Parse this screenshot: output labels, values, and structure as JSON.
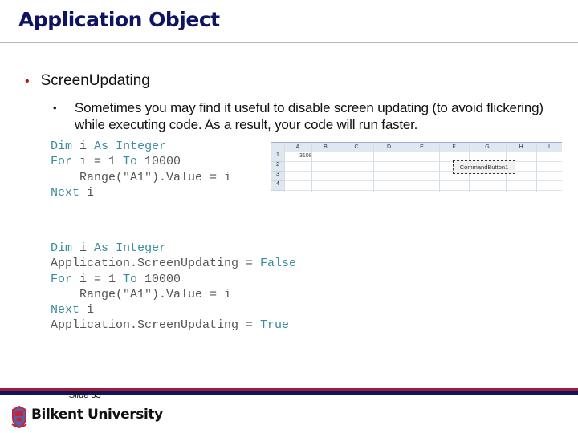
{
  "slide": {
    "title": "Application Object",
    "bullet_level1": "ScreenUpdating",
    "bullet_level2": "Sometimes you may find it useful to disable screen updating (to avoid flickering) while executing code. As a result, your code will run faster.",
    "bullet_char": "•"
  },
  "code_block_1": {
    "lines": [
      {
        "kw1": "Dim",
        "t1": " i ",
        "kw2": "As",
        "t2": " ",
        "kw3": "Integer",
        "t3": ""
      },
      {
        "kw1": "For",
        "t1": " i = 1 ",
        "kw2": "To",
        "t2": " 10000",
        "kw3": "",
        "t3": ""
      },
      {
        "kw1": "",
        "t1": "    Range(\"A1\").Value = i",
        "kw2": "",
        "t2": "",
        "kw3": "",
        "t3": ""
      },
      {
        "kw1": "Next",
        "t1": " i",
        "kw2": "",
        "t2": "",
        "kw3": "",
        "t3": ""
      }
    ]
  },
  "code_block_2": {
    "lines": [
      {
        "kw1": "Dim",
        "t1": " i ",
        "kw2": "As",
        "t2": " ",
        "kw3": "Integer",
        "t3": ""
      },
      {
        "kw1": "",
        "t1": "Application.ScreenUpdating = ",
        "kw2": "False",
        "t2": "",
        "kw3": "",
        "t3": ""
      },
      {
        "kw1": "For",
        "t1": " i = 1 ",
        "kw2": "To",
        "t2": " 10000",
        "kw3": "",
        "t3": ""
      },
      {
        "kw1": "",
        "t1": "    Range(\"A1\").Value = i",
        "kw2": "",
        "t2": "",
        "kw3": "",
        "t3": ""
      },
      {
        "kw1": "Next",
        "t1": " i",
        "kw2": "",
        "t2": "",
        "kw3": "",
        "t3": ""
      },
      {
        "kw1": "",
        "t1": "Application.ScreenUpdating = ",
        "kw2": "True",
        "t2": "",
        "kw3": "",
        "t3": ""
      }
    ]
  },
  "spreadsheet": {
    "columns": [
      "A",
      "B",
      "C",
      "D",
      "E",
      "F",
      "G",
      "H",
      "I"
    ],
    "rows": [
      "1",
      "2",
      "3",
      "4"
    ],
    "cell_a1": "3108",
    "command_button_label": "CommandButton1"
  },
  "footer": {
    "slide_number": "Slide 33",
    "institution": "Bilkent University",
    "colors": {
      "red": "#9c1d35",
      "blue": "#0e1461"
    }
  }
}
